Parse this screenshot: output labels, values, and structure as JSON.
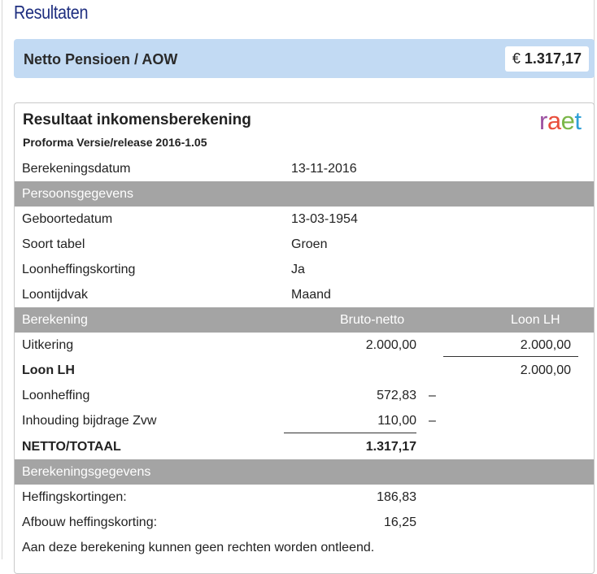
{
  "page": {
    "title": "Resultaten"
  },
  "netto": {
    "label": "Netto Pensioen / AOW",
    "currency": "€",
    "amount": "1.317,17"
  },
  "result": {
    "title": "Resultaat inkomensberekening",
    "subtitle": "Proforma Versie/release 2016-1.05",
    "logo": "raet",
    "logo_letters": [
      "r",
      "a",
      "e",
      "t"
    ],
    "calc_date_label": "Berekeningsdatum",
    "calc_date_value": "13-11-2016",
    "persons_header": "Persoonsgegevens",
    "persons": [
      {
        "label": "Geboortedatum",
        "value": "13-03-1954"
      },
      {
        "label": "Soort tabel",
        "value": "Groen"
      },
      {
        "label": "Loonheffingskorting",
        "value": "Ja"
      },
      {
        "label": "Loontijdvak",
        "value": "Maand"
      }
    ],
    "calc_header": {
      "label": "Berekening",
      "col1": "Bruto-netto",
      "col2": "Loon LH"
    },
    "calc_rows": [
      {
        "label": "Uitkering",
        "bruto": "2.000,00",
        "loon": "2.000,00",
        "sign": ""
      },
      {
        "label": "Loon LH",
        "bruto": "",
        "loon": "2.000,00",
        "sign": ""
      },
      {
        "label": "Loonheffing",
        "bruto": "572,83",
        "loon": "",
        "sign": "–"
      },
      {
        "label": "Inhouding bijdrage Zvw",
        "bruto": "110,00",
        "loon": "",
        "sign": "–"
      },
      {
        "label": "NETTO/TOTAAL",
        "bruto": "1.317,17",
        "loon": "",
        "sign": ""
      }
    ],
    "details_header": "Berekeningsgegevens",
    "details": [
      {
        "label": "Heffingskortingen:",
        "value": "186,83"
      },
      {
        "label": "Afbouw heffingskorting:",
        "value": "16,25"
      }
    ],
    "disclaimer": "Aan deze berekening kunnen geen rechten worden ontleend."
  }
}
